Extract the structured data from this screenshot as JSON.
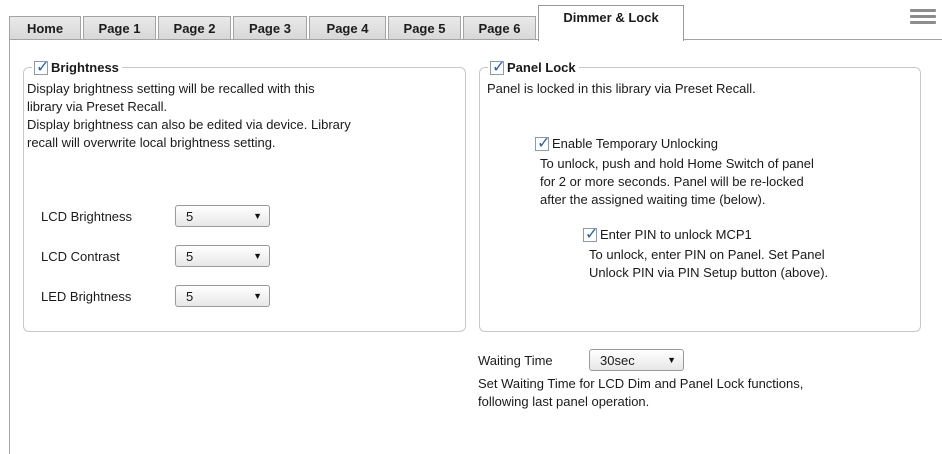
{
  "tabs": [
    {
      "label": "Home"
    },
    {
      "label": "Page 1"
    },
    {
      "label": "Page 2"
    },
    {
      "label": "Page 3"
    },
    {
      "label": "Page 4"
    },
    {
      "label": "Page 5"
    },
    {
      "label": "Page 6"
    },
    {
      "label": "Dimmer & Lock",
      "active": true
    }
  ],
  "menu_icon": "hamburger-menu-icon",
  "brightness": {
    "title": "Brightness",
    "checked": true,
    "desc": [
      "Display brightness setting will be recalled with this",
      "library via Preset Recall.",
      "Display brightness can also be edited via device. Library",
      "recall will overwrite local brightness setting."
    ],
    "fields": [
      {
        "label": "LCD Brightness",
        "value": "5"
      },
      {
        "label": "LCD Contrast",
        "value": "5"
      },
      {
        "label": "LED Brightness",
        "value": "5"
      }
    ]
  },
  "panel_lock": {
    "title": "Panel Lock",
    "checked": true,
    "desc": "Panel is locked in this library via Preset Recall.",
    "temp_unlock": {
      "label": "Enable Temporary Unlocking",
      "checked": true,
      "desc": [
        "To unlock, push and hold Home Switch of panel",
        "for 2 or more seconds. Panel will be re-locked",
        "after the assigned waiting time (below)."
      ]
    },
    "pin": {
      "label": "Enter PIN to unlock MCP1",
      "checked": true,
      "desc": [
        "To unlock, enter PIN on Panel. Set Panel",
        "Unlock PIN via PIN Setup button (above)."
      ]
    }
  },
  "waiting": {
    "label": "Waiting Time",
    "value": "30sec",
    "desc": [
      "Set Waiting Time for LCD Dim and Panel Lock functions,",
      "following last panel operation."
    ]
  },
  "colors": {
    "check": "#2b5fb8",
    "tab_bg": "#dcdcdc",
    "border": "#a4a4a4"
  }
}
